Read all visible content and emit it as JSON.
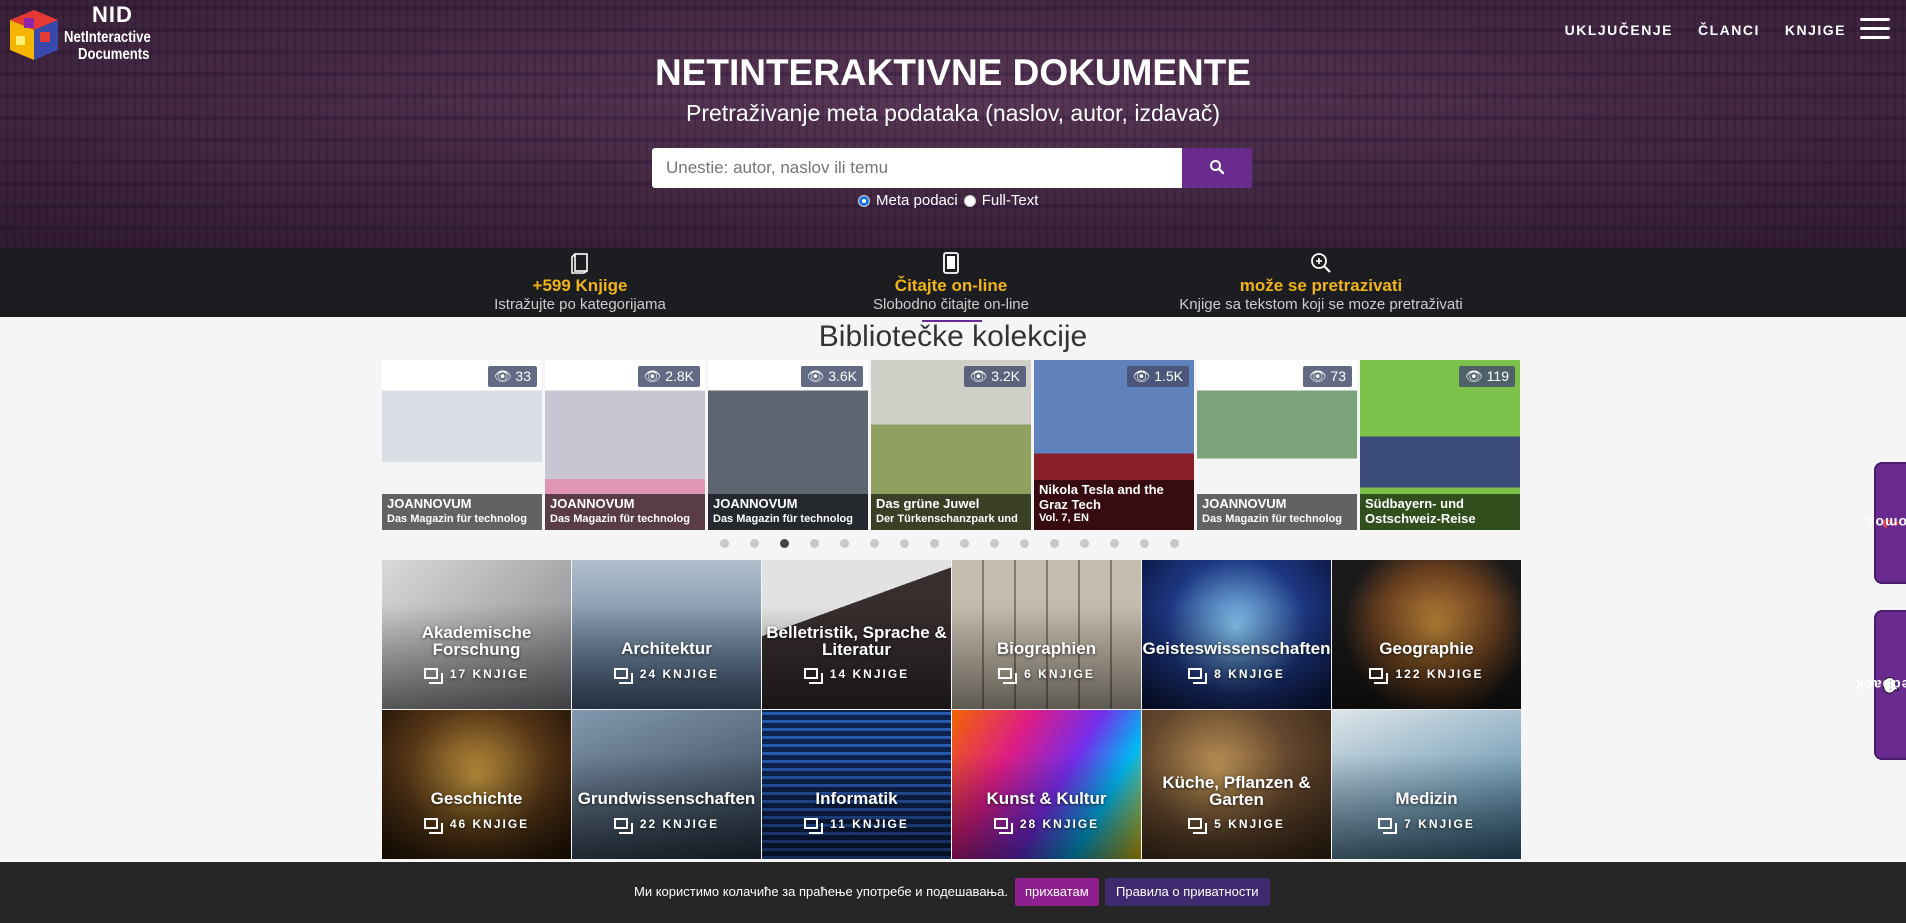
{
  "brand": {
    "abbr": "NID",
    "line1": "NetInteractive",
    "line2": "Documents"
  },
  "nav": {
    "items": [
      "UKLJUČENJE",
      "ČLANCI",
      "KNJIGE"
    ]
  },
  "hero": {
    "title": "NETINTERAKTIVNE DOKUMENTE",
    "subtitle": "Pretraživanje meta podataka (naslov, autor, izdavač)",
    "search_placeholder": "Unestie: autor, naslov ili temu",
    "radio_meta": "Meta podaci",
    "radio_full": "Full-Text"
  },
  "features": [
    {
      "icon": "book-icon",
      "title": "+599 Knjige",
      "sub": "Istražujte po kategorijama"
    },
    {
      "icon": "tablet-icon",
      "title": "Čitajte on-line",
      "sub": "Slobodno čitajte on-line"
    },
    {
      "icon": "zoom-in-icon",
      "title": "može se pretrazivati",
      "sub": "Knjige sa tekstom koji se moze pretraživati"
    }
  ],
  "collections": {
    "title": "Bibliotečke kolekcije",
    "items": [
      {
        "views": "33",
        "line1": "JOANNOVUM",
        "line2": "Das Magazin für technolog",
        "color": "#e8ecef"
      },
      {
        "views": "2.8K",
        "line1": "JOANNOVUM",
        "line2": "Das Magazin für technolog",
        "color": "#b9b6c4"
      },
      {
        "views": "3.6K",
        "line1": "JOANNOVUM",
        "line2": "Das Magazin für technolog",
        "color": "#7d8590"
      },
      {
        "views": "3.2K",
        "line1": "Das grüne Juwel",
        "line2": "Der Türkenschanzpark und",
        "color": "#a8b08a"
      },
      {
        "views": "1.5K",
        "line1": "Nikola Tesla and the",
        "line2": "Graz Tech",
        "line3": "Vol. 7, EN",
        "color": "#5f7fb5"
      },
      {
        "views": "73",
        "line1": "JOANNOVUM",
        "line2": "Das Magazin für technolog",
        "color": "#dfe6e3"
      },
      {
        "views": "119",
        "line1": "Südbayern- und",
        "line2": "Ostschweiz-Reise",
        "color": "#7cc24a"
      }
    ],
    "dots_total": 16,
    "dots_active_index": 2
  },
  "categories": [
    {
      "name": "Akademische Forschung",
      "count": "17 KNJIGE",
      "bg": "#7d7f85"
    },
    {
      "name": "Architektur",
      "count": "24 KNJIGE",
      "bg": "#6d8aa8"
    },
    {
      "name": "Belletristik, Sprache & Literatur",
      "count": "14 KNJIGE",
      "bg": "#4a4848"
    },
    {
      "name": "Biographien",
      "count": "6 KNJIGE",
      "bg": "#8f7a60"
    },
    {
      "name": "Geisteswissenschaften",
      "count": "8 KNJIGE",
      "bg": "#1e3a8a"
    },
    {
      "name": "Geographie",
      "count": "122 KNJIGE",
      "bg": "#2b2b2b"
    },
    {
      "name": "Geschichte",
      "count": "46 KNJIGE",
      "bg": "#6b4a24"
    },
    {
      "name": "Grundwissenschaften",
      "count": "22 KNJIGE",
      "bg": "#405468"
    },
    {
      "name": "Informatik",
      "count": "11 KNJIGE",
      "bg": "#1b3a7a"
    },
    {
      "name": "Kunst & Kultur",
      "count": "28 KNJIGE",
      "bg": "#b0407a"
    },
    {
      "name": "Küche, Pflanzen & Garten",
      "count": "5 KNJIGE",
      "bg": "#6a4b30"
    },
    {
      "name": "Medizin",
      "count": "7 KNJIGE",
      "bg": "#7fa9c2"
    }
  ],
  "sidetabs": {
    "help": "Pomoć",
    "feedback": "Feedback"
  },
  "cookie": {
    "text": "Ми користимо колачиће за праћење употребе и подешавања.",
    "accept": "прихватам",
    "policy": "Правила о приватности"
  },
  "colors": {
    "accent": "#6a2b8f",
    "gold": "#f0b418",
    "bar": "#1b1d21"
  }
}
